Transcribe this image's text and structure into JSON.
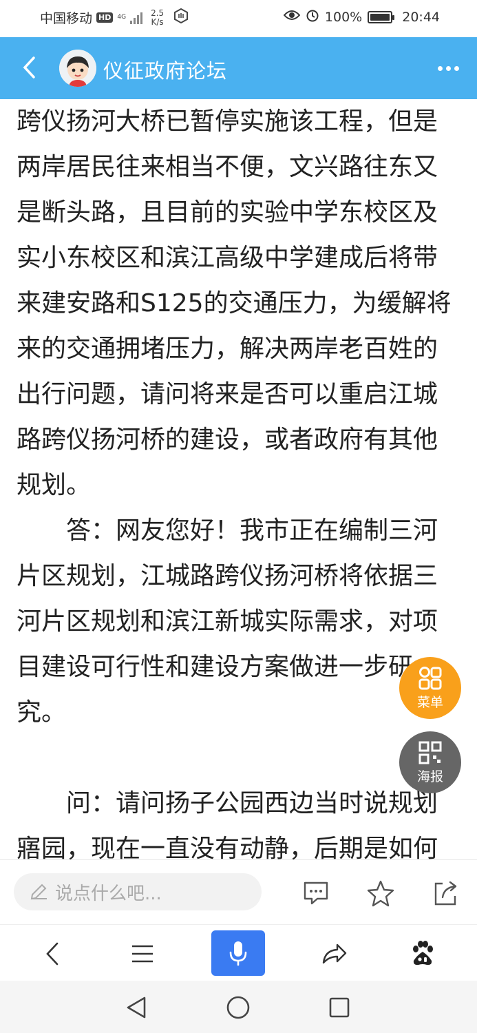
{
  "status_bar": {
    "carrier": "中国移动",
    "hd": "HD",
    "network": "4G",
    "speed_value": "2.5",
    "speed_unit": "K/s",
    "battery": "100%",
    "time": "20:44"
  },
  "header": {
    "title": "仪征政府论坛"
  },
  "article": {
    "paragraphs": [
      "跨仪扬河大桥已暂停实施该工程，但是两岸居民往来相当不便，文兴路往东又是断头路，且目前的实验中学东校区及实小东校区和滨江高级中学建成后将带来建安路和S125的交通压力，为缓解将来的交通拥堵压力，解决两岸老百姓的出行问题，请问将来是否可以重启江城路跨仪扬河桥的建设，或者政府有其他规划。",
      "答：网友您好！我市正在编制三河片区规划，江城路跨仪扬河桥将依据三河片区规划和滨江新城实际需求，对项目建设可行性和建设方案做进一步研究。",
      "问：请问扬子公园西边当时说规划寤园，现在一直没有动静，后期是如何"
    ]
  },
  "fab": {
    "menu_label": "菜单",
    "poster_label": "海报"
  },
  "comment_bar": {
    "placeholder": "说点什么吧..."
  },
  "colors": {
    "header_bg": "#4ab1f0",
    "menu_fab": "#f9a01b",
    "poster_fab": "#666666",
    "mic_button": "#3a7bf2"
  }
}
